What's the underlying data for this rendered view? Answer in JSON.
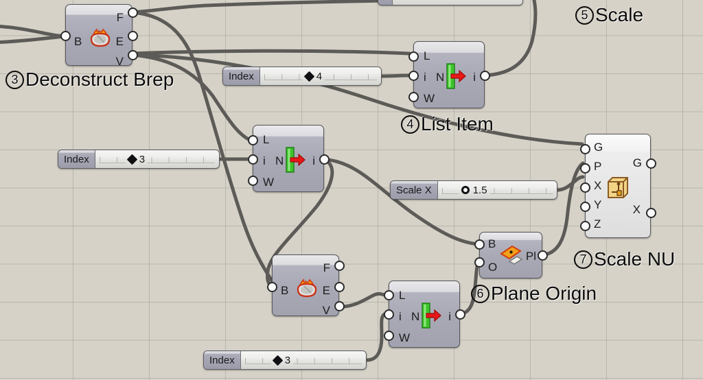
{
  "canvas": {
    "background_color": "#d6d2c8",
    "grid_color": "#96948c",
    "wire_color": "#5d5b57"
  },
  "nodes": [
    {
      "id": "deconstruct-brep-top",
      "component": "Deconstruct Brep",
      "icon": "brep-flame-icon",
      "inputs": [
        "B"
      ],
      "outputs": [
        "F",
        "E",
        "V"
      ]
    },
    {
      "id": "list-item-top",
      "component": "List Item",
      "icon": "list-item-arrow-icon",
      "inputs": [
        "L",
        "i",
        "W"
      ],
      "outputs": [
        "i"
      ]
    },
    {
      "id": "list-item-mid",
      "component": "List Item",
      "icon": "list-item-arrow-icon",
      "inputs": [
        "L",
        "i",
        "W"
      ],
      "outputs": [
        "i"
      ]
    },
    {
      "id": "deconstruct-brep-bottom",
      "component": "Deconstruct Brep",
      "icon": "brep-flame-icon",
      "inputs": [
        "B"
      ],
      "outputs": [
        "F",
        "E",
        "V"
      ]
    },
    {
      "id": "list-item-bottom",
      "component": "List Item",
      "icon": "list-item-arrow-icon",
      "inputs": [
        "L",
        "i",
        "W"
      ],
      "outputs": [
        "i"
      ]
    },
    {
      "id": "plane-origin",
      "component": "Plane Origin",
      "icon": "plane-origin-icon",
      "inputs": [
        "B",
        "O"
      ],
      "outputs": [
        "Pl"
      ]
    },
    {
      "id": "scale-nu",
      "component": "Scale NU",
      "icon": "scale-nu-box-icon",
      "inputs": [
        "G",
        "P",
        "X",
        "Y",
        "Z"
      ],
      "outputs": [
        "G",
        "X"
      ]
    }
  ],
  "sliders": [
    {
      "id": "index-top",
      "label": "Index",
      "value": "4",
      "handle": "diamond"
    },
    {
      "id": "index-mid",
      "label": "Index",
      "value": "3",
      "handle": "diamond"
    },
    {
      "id": "scale-x",
      "label": "Scale X",
      "value": "1.5",
      "handle": "circle"
    },
    {
      "id": "index-bottom",
      "label": "Index",
      "value": "3",
      "handle": "diamond"
    }
  ],
  "annotations": [
    {
      "id": "ann-3",
      "number": "3",
      "text": "Deconstruct Brep"
    },
    {
      "id": "ann-4",
      "number": "4",
      "text": "List Item"
    },
    {
      "id": "ann-5",
      "number": "5",
      "text": "Scale"
    },
    {
      "id": "ann-6",
      "number": "6",
      "text": "Plane Origin"
    },
    {
      "id": "ann-7",
      "number": "7",
      "text": "Scale NU"
    }
  ]
}
